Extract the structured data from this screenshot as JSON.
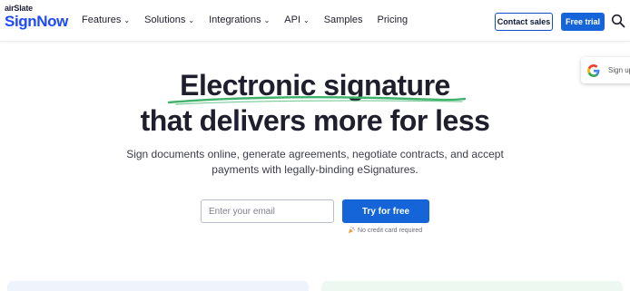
{
  "header": {
    "logo_prefix": "airSlate",
    "logo_brand": "SignNow",
    "nav": [
      {
        "label": "Features",
        "dropdown": true
      },
      {
        "label": "Solutions",
        "dropdown": true
      },
      {
        "label": "Integrations",
        "dropdown": true
      },
      {
        "label": "API",
        "dropdown": true
      },
      {
        "label": "Samples",
        "dropdown": false
      },
      {
        "label": "Pricing",
        "dropdown": false
      }
    ],
    "contact_label": "Contact sales",
    "trial_label": "Free trial",
    "search_icon": "search-icon"
  },
  "google_card": {
    "label": "Sign up",
    "icon": "google-icon"
  },
  "hero": {
    "title_line1": "Electronic signature",
    "title_line2": "that delivers more for less",
    "subtitle": "Sign documents online, generate agreements, negotiate contracts, and accept payments with legally-binding eSignatures."
  },
  "form": {
    "email_placeholder": "Enter your email",
    "email_value": "",
    "cta_label": "Try for free",
    "note": "No credit card required",
    "note_icon": "party-popper-icon"
  },
  "colors": {
    "brand_blue": "#1d4aff",
    "button_blue": "#1565d8",
    "underline_green": "#3fb26b"
  }
}
